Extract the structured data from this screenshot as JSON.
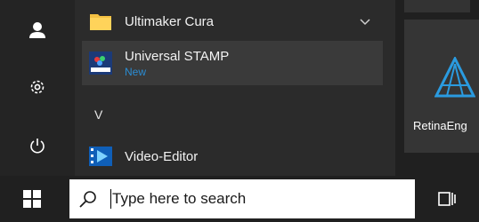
{
  "rail": {
    "icons": [
      "user-icon",
      "settings-icon",
      "power-icon"
    ]
  },
  "apps": [
    {
      "name": "Ultimaker Cura",
      "icon": "folder-icon",
      "expand_icon": "chevron-down-icon"
    },
    {
      "name": "Universal STAMP",
      "subtitle": "New",
      "icon": "stamp-icon"
    },
    {
      "letter": "V"
    },
    {
      "name": "Video-Editor",
      "icon": "video-editor-icon"
    }
  ],
  "tiles": {
    "retina": {
      "label": "RetinaEng",
      "icon": "retina-engine-icon"
    }
  },
  "taskbar": {
    "start_icon": "windows-icon",
    "search": {
      "placeholder": "Type here to search",
      "icon": "search-icon"
    },
    "task_view_icon": "task-view-icon"
  },
  "colors": {
    "accent": "#2a8dd4",
    "folder": "#f4c042",
    "background": "#2b2b2b",
    "taskbar": "#202020"
  }
}
